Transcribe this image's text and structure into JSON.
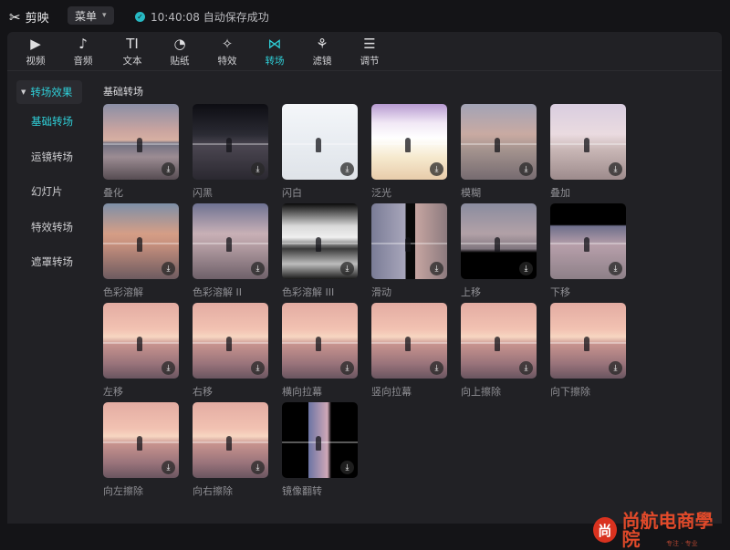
{
  "app": {
    "name": "剪映",
    "menu_label": "菜单",
    "save_status": "10:40:08 自动保存成功"
  },
  "toolbar": [
    {
      "label": "视频",
      "icon": "video-icon",
      "glyph": "▶"
    },
    {
      "label": "音频",
      "icon": "audio-icon",
      "glyph": "♪"
    },
    {
      "label": "文本",
      "icon": "text-icon",
      "glyph": "TI"
    },
    {
      "label": "贴纸",
      "icon": "sticker-icon",
      "glyph": "◔"
    },
    {
      "label": "特效",
      "icon": "effects-icon",
      "glyph": "✧"
    },
    {
      "label": "转场",
      "icon": "transition-icon",
      "glyph": "⋈",
      "active": true
    },
    {
      "label": "滤镜",
      "icon": "filter-icon",
      "glyph": "⚘"
    },
    {
      "label": "调节",
      "icon": "adjust-icon",
      "glyph": "☰"
    }
  ],
  "sidebar": {
    "header": "转场效果",
    "items": [
      {
        "label": "基础转场",
        "active": true
      },
      {
        "label": "运镜转场"
      },
      {
        "label": "幻灯片"
      },
      {
        "label": "特效转场"
      },
      {
        "label": "遮罩转场"
      }
    ]
  },
  "section_title": "基础转场",
  "transitions": [
    {
      "name": "叠化",
      "theme": "lake"
    },
    {
      "name": "闪黑",
      "theme": "dark"
    },
    {
      "name": "闪白",
      "theme": "white"
    },
    {
      "name": "泛光",
      "theme": "flare"
    },
    {
      "name": "模糊",
      "theme": "blur"
    },
    {
      "name": "叠加",
      "theme": "add"
    },
    {
      "name": "色彩溶解",
      "theme": "color"
    },
    {
      "name": "色彩溶解 II",
      "theme": "color2"
    },
    {
      "name": "色彩溶解 III",
      "theme": "color3"
    },
    {
      "name": "滑动",
      "theme": "slide"
    },
    {
      "name": "上移",
      "theme": "up"
    },
    {
      "name": "下移",
      "theme": "down"
    },
    {
      "name": "左移",
      "theme": "sunset"
    },
    {
      "name": "右移",
      "theme": "sunset"
    },
    {
      "name": "横向拉幕",
      "theme": "sunset"
    },
    {
      "name": "竖向拉幕",
      "theme": "sunset"
    },
    {
      "name": "向上擦除",
      "theme": "sunset"
    },
    {
      "name": "向下擦除",
      "theme": "sunset"
    },
    {
      "name": "向左擦除",
      "theme": "sunset"
    },
    {
      "name": "向右擦除",
      "theme": "sunset"
    },
    {
      "name": "镜像翻转",
      "theme": "mirror"
    }
  ],
  "watermark": {
    "title": "尚航电商學院",
    "badge": "尚",
    "subtitle": "专注 · 专业"
  }
}
